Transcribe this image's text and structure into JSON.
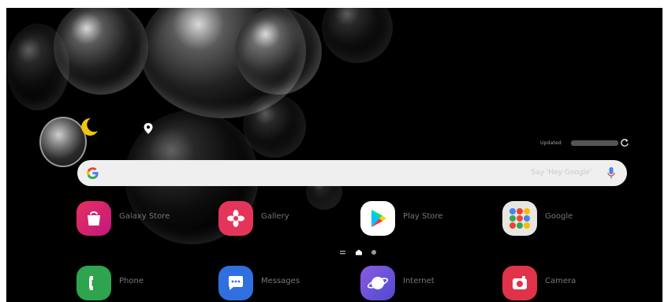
{
  "weather": {
    "updated_label": "Updated"
  },
  "search": {
    "placeholder": "Say 'Hey Google'"
  },
  "apps_row1": [
    {
      "label": "Galaxy Store",
      "color": "#e0336f"
    },
    {
      "label": "Gallery",
      "color": "#e5345a"
    },
    {
      "label": "Play Store",
      "color": "#ffffff"
    },
    {
      "label": "Google",
      "color": "#e8e6e1"
    }
  ],
  "apps_row2": [
    {
      "label": "Phone",
      "color": "#2ea44f"
    },
    {
      "label": "Messages",
      "color": "#2f6fe0"
    },
    {
      "label": "Internet",
      "color": "#6d5ad8"
    },
    {
      "label": "Camera",
      "color": "#e0334a"
    }
  ],
  "page_indicator": {
    "pages": 2,
    "current": 1
  },
  "icons": [
    "moon-icon",
    "location-pin-icon",
    "refresh-icon",
    "google-g-icon",
    "mic-icon",
    "shopping-bag-icon",
    "flower-icon",
    "play-icon",
    "app-folder-icon",
    "phone-icon",
    "chat-bubble-icon",
    "planet-icon",
    "camera-icon"
  ]
}
